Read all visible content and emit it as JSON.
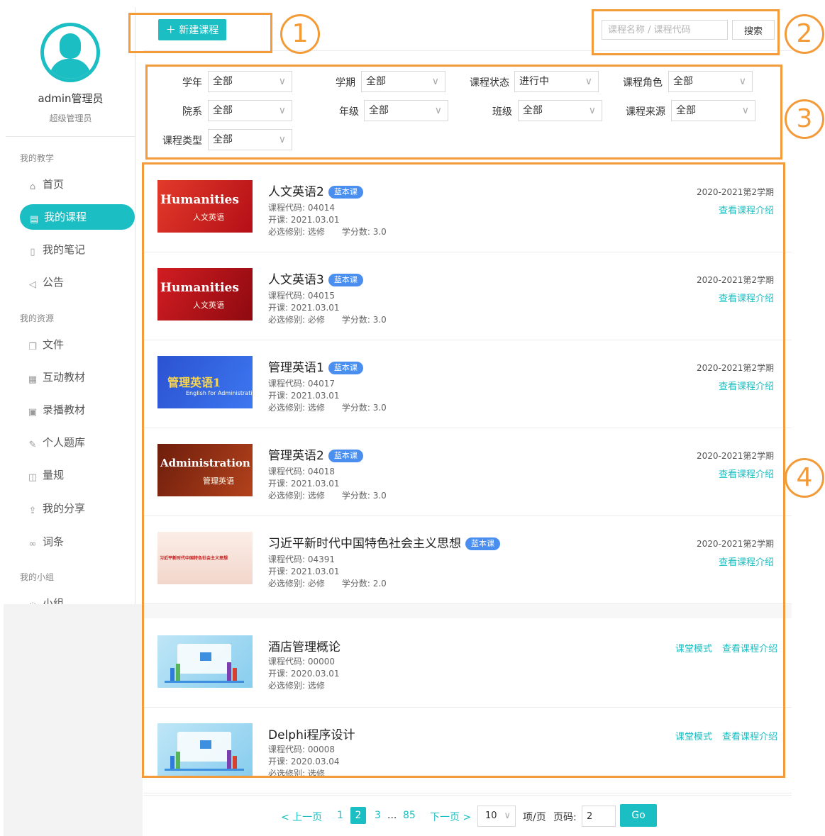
{
  "user": {
    "name": "admin管理员",
    "role": "超级管理员"
  },
  "sidebar": {
    "sections": [
      {
        "title": "我的教学"
      },
      {
        "title": "我的资源"
      },
      {
        "title": "我的小组"
      }
    ],
    "items": [
      {
        "label": "首页",
        "icon": "home-icon"
      },
      {
        "label": "我的课程",
        "icon": "course-icon"
      },
      {
        "label": "我的笔记",
        "icon": "note-icon"
      },
      {
        "label": "公告",
        "icon": "announcement-icon"
      },
      {
        "label": "文件",
        "icon": "file-icon"
      },
      {
        "label": "互动教材",
        "icon": "interactive-book-icon"
      },
      {
        "label": "录播教材",
        "icon": "video-book-icon"
      },
      {
        "label": "个人题库",
        "icon": "question-bank-icon"
      },
      {
        "label": "量规",
        "icon": "rubric-icon"
      },
      {
        "label": "我的分享",
        "icon": "share-icon"
      },
      {
        "label": "词条",
        "icon": "link-icon"
      },
      {
        "label": "小组",
        "icon": "group-icon"
      }
    ]
  },
  "toolbar": {
    "new_course": "＋ 新建课程",
    "search_placeholder": "课程名称 / 课程代码",
    "search_button": "搜索"
  },
  "filters": [
    {
      "label": "学年",
      "value": "全部"
    },
    {
      "label": "学期",
      "value": "全部"
    },
    {
      "label": "课程状态",
      "value": "进行中"
    },
    {
      "label": "课程角色",
      "value": "全部"
    },
    {
      "label": "院系",
      "value": "全部"
    },
    {
      "label": "年级",
      "value": "全部"
    },
    {
      "label": "班级",
      "value": "全部"
    },
    {
      "label": "课程来源",
      "value": "全部"
    },
    {
      "label": "课程类型",
      "value": "全部"
    }
  ],
  "courses": [
    {
      "title": "人文英语2",
      "badge": "蓝本课",
      "code": "课程代码: 04014",
      "start": "开课: 2021.03.01",
      "type": "必选修别: 选修",
      "credit": "学分数: 3.0",
      "term": "2020-2021第2学期",
      "link": "查看课程介绍",
      "thumb": "Humanities",
      "thumb_sub": "人文英语",
      "thumb_color": "#d9231f"
    },
    {
      "title": "人文英语3",
      "badge": "蓝本课",
      "code": "课程代码: 04015",
      "start": "开课: 2021.03.01",
      "type": "必选修别: 必修",
      "credit": "学分数: 3.0",
      "term": "2020-2021第2学期",
      "link": "查看课程介绍",
      "thumb": "Humanities",
      "thumb_sub": "人文英语",
      "thumb_color": "#c8141c"
    },
    {
      "title": "管理英语1",
      "badge": "蓝本课",
      "code": "课程代码: 04017",
      "start": "开课: 2021.03.01",
      "type": "必选修别: 选修",
      "credit": "学分数: 3.0",
      "term": "2020-2021第2学期",
      "link": "查看课程介绍",
      "thumb": "管理英语1",
      "thumb_sub": "English for Administration",
      "thumb_color": "#2f5fd8"
    },
    {
      "title": "管理英语2",
      "badge": "蓝本课",
      "code": "课程代码: 04018",
      "start": "开课: 2021.03.01",
      "type": "必选修别: 选修",
      "credit": "学分数: 3.0",
      "term": "2020-2021第2学期",
      "link": "查看课程介绍",
      "thumb": "Administration",
      "thumb_sub": "管理英语",
      "thumb_color": "#8a2b12"
    },
    {
      "title": "习近平新时代中国特色社会主义思想",
      "badge": "蓝本课",
      "code": "课程代码: 04391",
      "start": "开课: 2021.03.01",
      "type": "必选修别: 必修",
      "credit": "学分数: 2.0",
      "term": "2020-2021第2学期",
      "link": "查看课程介绍",
      "thumb": "习近平新时代中国特色社会主义思想",
      "thumb_sub": "",
      "thumb_color": "#f7e3dc"
    }
  ],
  "other_courses": [
    {
      "title": "酒店管理概论",
      "code": "课程代码: 00000",
      "start": "开课: 2020.03.01",
      "type": "必选修别: 选修",
      "link_class": "课堂模式",
      "link_intro": "查看课程介绍"
    },
    {
      "title": "Delphi程序设计",
      "code": "课程代码: 00008",
      "start": "开课: 2020.03.04",
      "type": "必选修别: 选修",
      "link_class": "课堂模式",
      "link_intro": "查看课程介绍"
    }
  ],
  "pagination": {
    "prev": "< 上一页",
    "p1": "1",
    "p2": "2",
    "p3": "3",
    "ellipsis": "...",
    "last": "85",
    "next": "下一页 >",
    "page_size": "10",
    "per_page_label": "项/页",
    "page_label": "页码:",
    "page_input": "2",
    "go": "Go"
  },
  "annotations": {
    "n1": "1",
    "n2": "2",
    "n3": "3",
    "n4": "4",
    "color": "#f29b38"
  },
  "colors": {
    "accent": "#1bbec2",
    "badge": "#4a8ef0"
  }
}
